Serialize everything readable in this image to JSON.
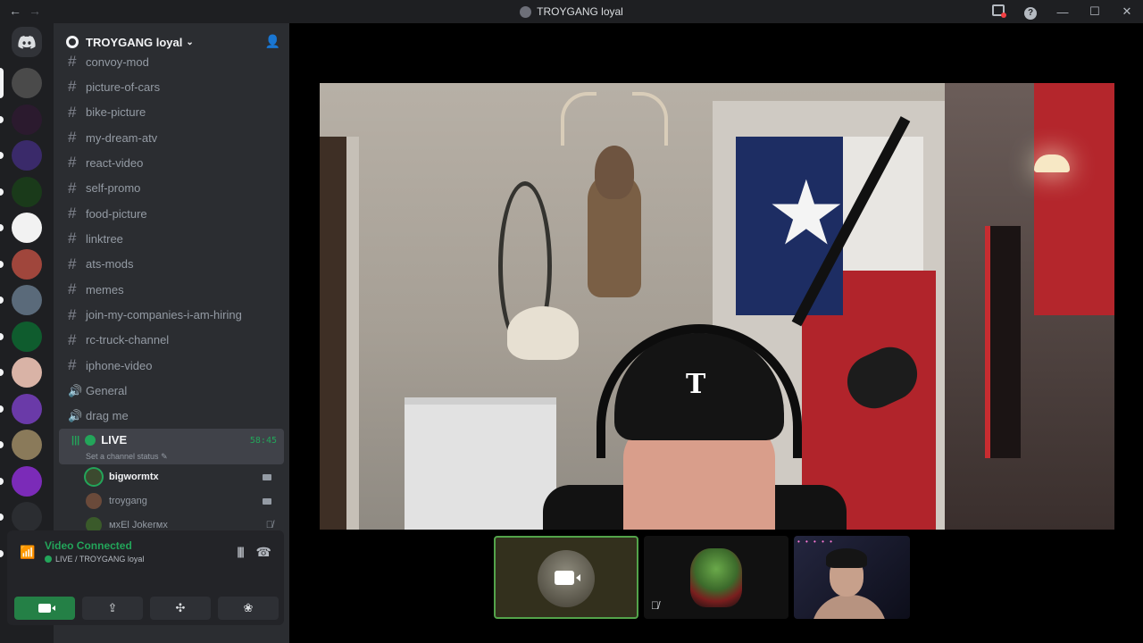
{
  "window": {
    "title": "TROYGANG loyal",
    "back_glyph": "←",
    "forward_glyph": "→",
    "min_glyph": "—",
    "max_glyph": "☐",
    "close_glyph": "✕",
    "help_glyph": "?"
  },
  "server": {
    "name": "TROYGANG loyal",
    "chevron": "⌄",
    "invite_glyph": "👤"
  },
  "channels": [
    {
      "name": "convoy-mod",
      "type": "text"
    },
    {
      "name": "picture-of-cars",
      "type": "text"
    },
    {
      "name": "bike-picture",
      "type": "text"
    },
    {
      "name": "my-dream-atv",
      "type": "text"
    },
    {
      "name": "react-video",
      "type": "text"
    },
    {
      "name": "self-promo",
      "type": "text"
    },
    {
      "name": "food-picture",
      "type": "text"
    },
    {
      "name": "linktree",
      "type": "text"
    },
    {
      "name": "ats-mods",
      "type": "text"
    },
    {
      "name": "memes",
      "type": "text"
    },
    {
      "name": "join-my-companies-i-am-hiring",
      "type": "text"
    },
    {
      "name": "rc-truck-channel",
      "type": "text"
    },
    {
      "name": "iphone-video",
      "type": "text"
    },
    {
      "name": "General",
      "type": "voice"
    },
    {
      "name": "drag me",
      "type": "voice"
    }
  ],
  "glyphs": {
    "hash": "#",
    "speaker": "🔊",
    "pencil": "✎",
    "mic_off": "🎙̸",
    "bars": "|||"
  },
  "live_channel": {
    "name": "LIVE",
    "status_placeholder": "Set a channel status",
    "timer": "58:45"
  },
  "voice_members": [
    {
      "name": "bigwormtx",
      "speaking": true,
      "video": true
    },
    {
      "name": "troygang",
      "speaking": false,
      "video": true
    },
    {
      "name": "мхEl Jokerмх",
      "speaking": false,
      "muted": true
    }
  ],
  "voice_panel": {
    "status": "Video Connected",
    "location": "LIVE / TROYGANG loyal",
    "noise_glyph": "|||||",
    "hangup_glyph": "☎",
    "buttons": [
      {
        "name": "camera",
        "glyph": ""
      },
      {
        "name": "screen-share",
        "glyph": "⇪"
      },
      {
        "name": "activities",
        "glyph": "✣"
      },
      {
        "name": "soundboard",
        "glyph": "❀"
      }
    ]
  },
  "video": {
    "main_logo": "T",
    "thumb_mute_glyph": "🎙̸",
    "lights_text": "• • • • •"
  },
  "colors": {
    "green": "#23a55a",
    "sidebar_bg": "#2b2d31",
    "guild_bg": "#1e1f22",
    "selected_bg": "#404249",
    "active_thumb_border": "#53a34a"
  },
  "guilds": [
    {
      "name": "guild-1",
      "color": "#4a4a4a"
    },
    {
      "name": "guild-deejays-inferno",
      "color": "#2b1a2e"
    },
    {
      "name": "guild-3",
      "color": "#3a2a6a"
    },
    {
      "name": "guild-4",
      "color": "#1a3a1a"
    },
    {
      "name": "guild-5",
      "color": "#f2f2f2"
    },
    {
      "name": "guild-6",
      "color": "#a0463c"
    },
    {
      "name": "guild-7",
      "color": "#5a6a7a"
    },
    {
      "name": "guild-8",
      "color": "#0f5c2e"
    },
    {
      "name": "guild-9",
      "color": "#d9b3a6"
    },
    {
      "name": "guild-10",
      "color": "#6a3aa8"
    },
    {
      "name": "guild-11",
      "color": "#8a7a5a"
    },
    {
      "name": "guild-andii-skwad",
      "color": "#7b2bb8"
    },
    {
      "name": "guild-13",
      "color": "#2b2d31"
    },
    {
      "name": "guild-14",
      "color": "#8a5a4a"
    }
  ]
}
